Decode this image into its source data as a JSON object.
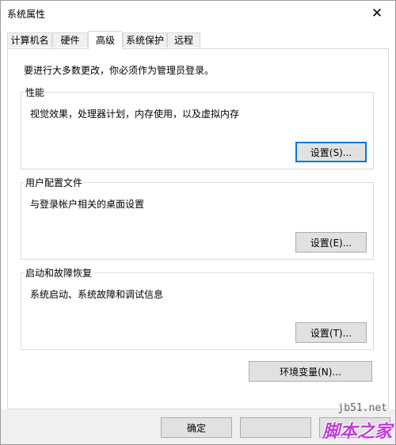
{
  "window": {
    "title": "系统属性",
    "close_glyph": "✕"
  },
  "tabs": [
    {
      "label": "计算机名",
      "active": false
    },
    {
      "label": "硬件",
      "active": false
    },
    {
      "label": "高级",
      "active": true
    },
    {
      "label": "系统保护",
      "active": false
    },
    {
      "label": "远程",
      "active": false
    }
  ],
  "advanced": {
    "intro": "要进行大多数更改，你必须作为管理员登录。",
    "performance": {
      "title": "性能",
      "description": "视觉效果，处理器计划，内存使用，以及虚拟内存",
      "button": "设置(S)..."
    },
    "profiles": {
      "title": "用户配置文件",
      "description": "与登录帐户相关的桌面设置",
      "button": "设置(E)..."
    },
    "startup": {
      "title": "启动和故障恢复",
      "description": "系统启动、系统故障和调试信息",
      "button": "设置(T)..."
    },
    "env_button": "环境变量(N)..."
  },
  "footer": {
    "ok": "确定",
    "cancel": "",
    "apply": ""
  },
  "watermark": {
    "url": "jb51.net",
    "text": "脚本之家"
  },
  "colors": {
    "focus": "#0078d7",
    "button_face": "#e1e1e1",
    "dialog_bg": "#f0f0f0",
    "watermark": "#c03bd8"
  }
}
